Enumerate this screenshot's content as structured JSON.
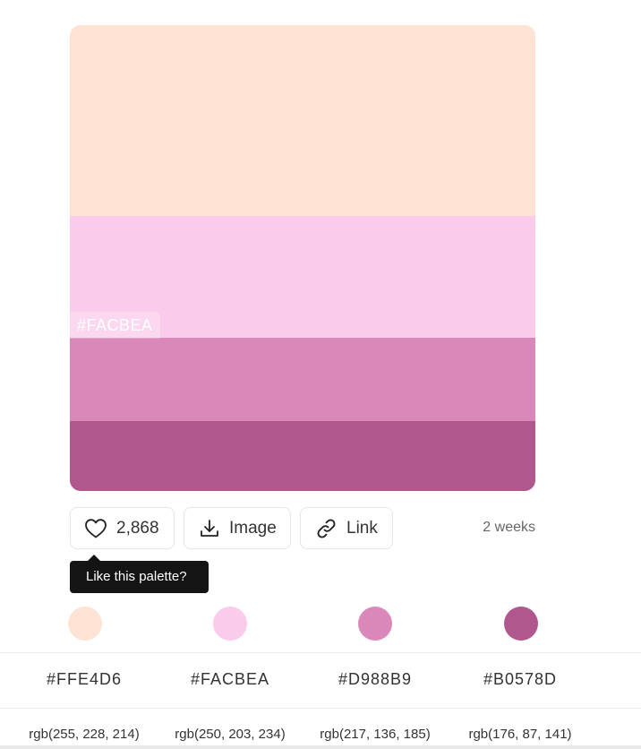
{
  "palette": {
    "colors": [
      {
        "hex": "#FFE4D6",
        "rgb": "rgb(255, 228, 214)"
      },
      {
        "hex": "#FACBEA",
        "rgb": "rgb(250, 203, 234)"
      },
      {
        "hex": "#D988B9",
        "rgb": "rgb(217, 136, 185)"
      },
      {
        "hex": "#B0578D",
        "rgb": "rgb(176, 87, 141)"
      }
    ],
    "hovered_hex": "#FACBEA"
  },
  "actions": {
    "likes": "2,868",
    "image_label": "Image",
    "link_label": "Link",
    "time_ago": "2 weeks",
    "tooltip": "Like this palette?"
  },
  "icons": {
    "like": "heart-icon",
    "image": "download-icon",
    "link": "link-icon"
  }
}
